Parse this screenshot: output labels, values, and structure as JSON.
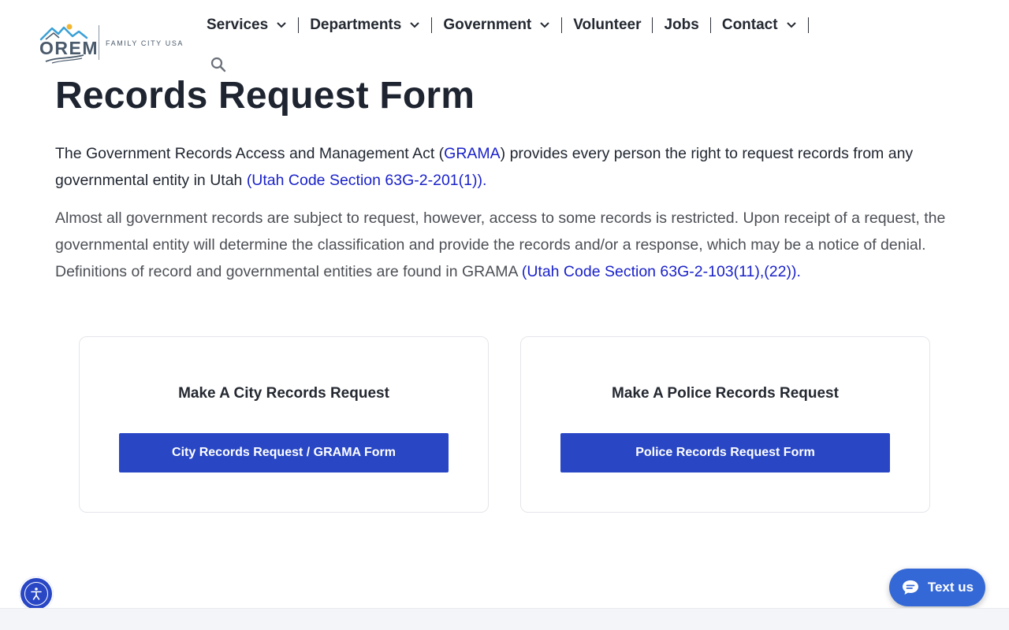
{
  "logo": {
    "wordmark": "OREM",
    "tagline": "FAMILY CITY USA"
  },
  "nav": {
    "items": [
      {
        "label": "Services",
        "has_dropdown": true
      },
      {
        "label": "Departments",
        "has_dropdown": true
      },
      {
        "label": "Government",
        "has_dropdown": true
      },
      {
        "label": "Volunteer",
        "has_dropdown": false
      },
      {
        "label": "Jobs",
        "has_dropdown": false
      },
      {
        "label": "Contact",
        "has_dropdown": true
      }
    ],
    "search_icon": "search-icon"
  },
  "main": {
    "title": "Records Request Form",
    "intro": {
      "before": "The Government Records Access and Management Act (",
      "link1": "GRAMA",
      "middle": ") provides every person the right to request records from any governmental entity in Utah ",
      "link2": "(Utah Code Section 63G-2-201(1))."
    },
    "desc": {
      "text": "Almost all government records are subject to request, however, access to some records is restricted. Upon receipt of a request, the governmental entity will determine the classification and provide the records and/or a response, which may be a notice of denial. Definitions of record and governmental entities are found in GRAMA ",
      "link": "(Utah Code Section 63G-2-103(11),(22))."
    },
    "cards": [
      {
        "title": "Make A City Records Request",
        "button": "City Records Request / GRAMA Form"
      },
      {
        "title": "Make A Police Records Request",
        "button": "Police Records Request Form"
      }
    ]
  },
  "floating": {
    "accessibility_icon": "accessibility-icon",
    "text_us": {
      "label": "Text us",
      "icon": "chat-bubble-icon"
    }
  },
  "colors": {
    "primary_button": "#2947c5",
    "link": "#1a22c9",
    "text_us_bg": "#3468d6",
    "heading": "#1e2430"
  }
}
